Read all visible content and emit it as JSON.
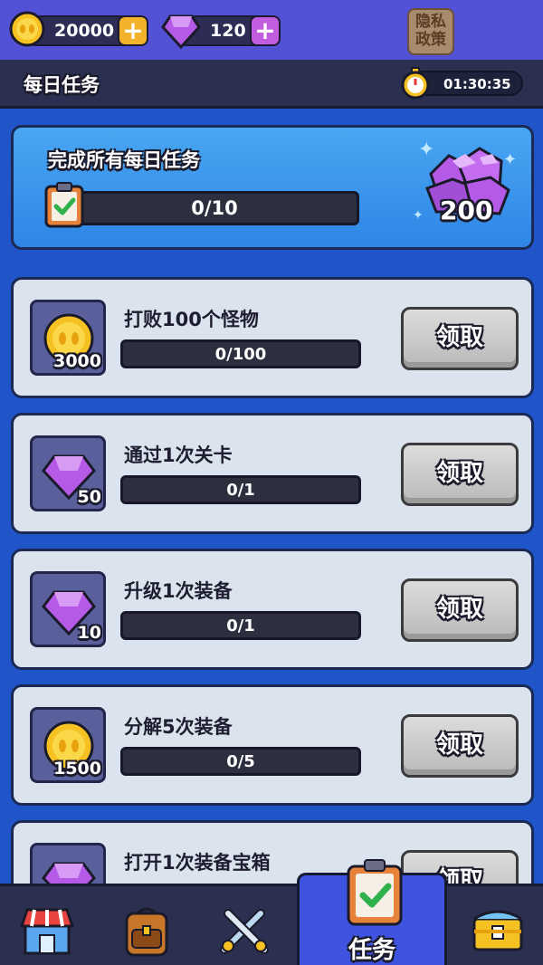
{
  "topbar": {
    "coins": "20000",
    "gems": "120",
    "plus_label": "+",
    "privacy_label_1": "隐私",
    "privacy_label_2": "政策"
  },
  "header": {
    "title": "每日任务",
    "timer": "01:30:35"
  },
  "daily": {
    "title": "完成所有每日任务",
    "progress": "0/10",
    "progress_fraction": 0,
    "reward": "200"
  },
  "tasks": [
    {
      "title": "打败100个怪物",
      "progress": "0/100",
      "reward": "3000",
      "reward_type": "coin-icon",
      "claim": "领取"
    },
    {
      "title": "通过1次关卡",
      "progress": "0/1",
      "reward": "50",
      "reward_type": "gem-icon",
      "claim": "领取"
    },
    {
      "title": "升级1次装备",
      "progress": "0/1",
      "reward": "10",
      "reward_type": "gem-icon",
      "claim": "领取"
    },
    {
      "title": "分解5次装备",
      "progress": "0/5",
      "reward": "1500",
      "reward_type": "coin-icon",
      "claim": "领取"
    },
    {
      "title": "打开1次装备宝箱",
      "progress": "",
      "reward": "",
      "reward_type": "gem-icon",
      "claim": "领取"
    }
  ],
  "nav": {
    "items": [
      "shop-icon",
      "backpack-icon",
      "battle-icon",
      "task-icon",
      "treasure-icon"
    ],
    "active_label": "任务"
  },
  "colors": {
    "background": "#1f55c9",
    "card": "#dae3ee",
    "coin": "#f6c223",
    "gem": "#b55ae6",
    "active_tab": "#3e53e0"
  }
}
